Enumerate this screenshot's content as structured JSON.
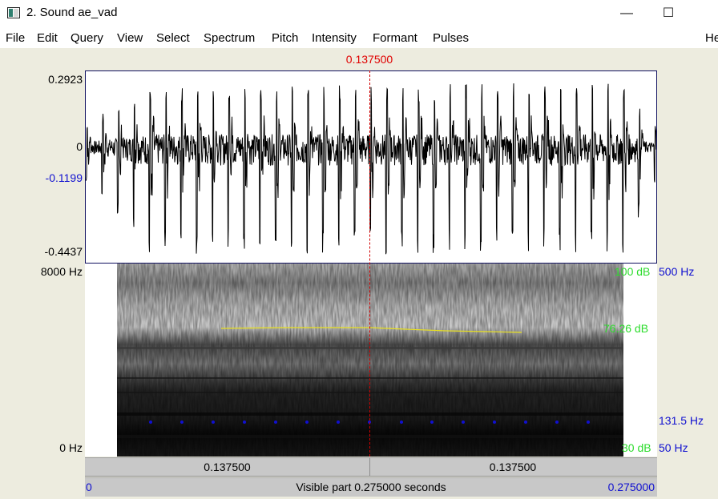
{
  "window": {
    "title": "2. Sound ae_vad",
    "minimize_glyph": "—",
    "maximize_glyph": "☐",
    "close_glyph": ""
  },
  "menu": [
    "File",
    "Edit",
    "Query",
    "View",
    "Select",
    "Spectrum",
    "Pitch",
    "Intensity",
    "Formant",
    "Pulses",
    "He"
  ],
  "editor": {
    "cursor_time": "0.137500",
    "waveform": {
      "max_label": "0.2923",
      "zero_label": "0",
      "cursor_value_label": "-0.1199",
      "min_label": "-0.4437"
    },
    "spectrogram": {
      "top_freq_label": "8000 Hz",
      "bottom_freq_label": "0 Hz",
      "intensity_top_label": "100 dB",
      "intensity_value_label": "76.26 dB",
      "intensity_bottom_label": "30 dB",
      "pitch_top_label": "500 Hz",
      "pitch_value_label": "131.5 Hz",
      "pitch_bottom_label": "50 Hz"
    },
    "selection_bar": {
      "left_label": "0.137500",
      "right_label": "0.137500"
    },
    "visible_bar": {
      "start_label": "0",
      "center_label": "Visible part 0.275000 seconds",
      "end_label": "0.275000"
    }
  },
  "colors": {
    "cursor": "#e00000",
    "pitch_dots": "#1010d0",
    "intensity_line": "#e8e020",
    "db_labels": "#2ddc2d",
    "hz_labels": "#1010d0"
  }
}
